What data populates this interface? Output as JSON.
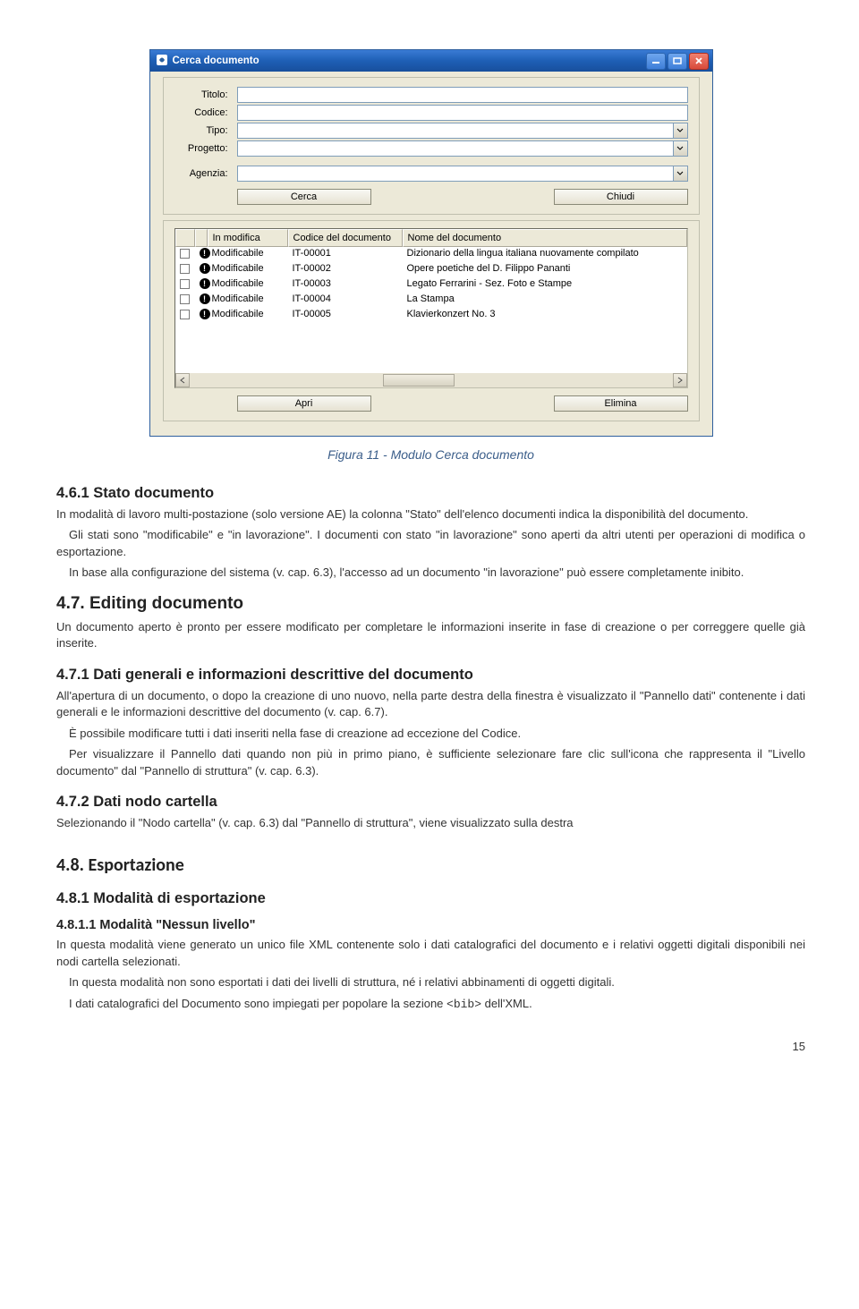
{
  "dialog": {
    "title": "Cerca documento",
    "labels": {
      "titolo": "Titolo:",
      "codice": "Codice:",
      "tipo": "Tipo:",
      "progetto": "Progetto:",
      "agenzia": "Agenzia:"
    },
    "buttons": {
      "cerca": "Cerca",
      "chiudi": "Chiudi",
      "apri": "Apri",
      "elimina": "Elimina"
    },
    "columns": {
      "inmod": "In modifica",
      "codice": "Codice del documento",
      "nome": "Nome del documento"
    },
    "rows": [
      {
        "mod": "Modificabile",
        "cod": "IT-00001",
        "nom": "Dizionario della lingua italiana nuovamente compilato"
      },
      {
        "mod": "Modificabile",
        "cod": "IT-00002",
        "nom": "Opere poetiche del D. Filippo Pananti"
      },
      {
        "mod": "Modificabile",
        "cod": "IT-00003",
        "nom": "Legato Ferrarini - Sez. Foto e Stampe"
      },
      {
        "mod": "Modificabile",
        "cod": "IT-00004",
        "nom": "La Stampa"
      },
      {
        "mod": "Modificabile",
        "cod": "IT-00005",
        "nom": "Klavierkonzert No. 3"
      }
    ]
  },
  "caption": "Figura 11 - Modulo Cerca documento",
  "sections": {
    "s461_title": "4.6.1 Stato documento",
    "s461_p1": "In modalità di lavoro multi-postazione (solo versione AE) la colonna \"Stato\" dell'elenco documenti indica la disponibilità del documento.",
    "s461_p2": "Gli stati sono \"modificabile\" e \"in lavorazione\". I documenti con stato \"in lavorazione\" sono aperti da altri utenti per operazioni di modifica o esportazione.",
    "s461_p3": "In base alla configurazione del sistema (v. cap. 6.3), l'accesso ad un documento \"in lavorazione\" può essere completamente inibito.",
    "s47_title": "4.7. Editing documento",
    "s47_p1": "Un documento aperto è pronto per essere modificato per completare le informazioni inserite in fase di creazione o per correggere quelle già inserite.",
    "s471_title": "4.7.1 Dati generali e informazioni descrittive del documento",
    "s471_p1": "All'apertura di un documento, o dopo la creazione di uno nuovo, nella parte destra della finestra è visualizzato il \"Pannello dati\" contenente i dati generali e le informazioni descrittive del documento (v. cap. 6.7).",
    "s471_p2": "È possibile modificare tutti i dati inseriti nella fase di creazione ad eccezione del Codice.",
    "s471_p3": "Per visualizzare il Pannello dati quando non più in primo piano, è sufficiente selezionare fare clic sull'icona che rappresenta il \"Livello documento\" dal \"Pannello di struttura\" (v. cap. 6.3).",
    "s472_title": "4.7.2 Dati nodo cartella",
    "s472_p1": "Selezionando il \"Nodo cartella\" (v. cap. 6.3) dal \"Pannello di struttura\", viene visualizzato sulla destra",
    "s48_title": "4.8. Esportazione",
    "s481_title": "4.8.1 Modalità di esportazione",
    "s4811_title": "4.8.1.1 Modalità \"Nessun livello\"",
    "s4811_p1": "In questa modalità viene generato un unico file XML contenente solo i dati catalografici del documento e i relativi oggetti digitali disponibili nei nodi cartella selezionati.",
    "s4811_p2": "In questa modalità non sono esportati i dati dei livelli di struttura, né i relativi abbinamenti di oggetti digitali.",
    "s4811_p3a": "I dati catalografici del Documento sono impiegati per popolare la sezione ",
    "s4811_p3b": "<bib>",
    "s4811_p3c": " dell'XML."
  },
  "pagenum": "15"
}
